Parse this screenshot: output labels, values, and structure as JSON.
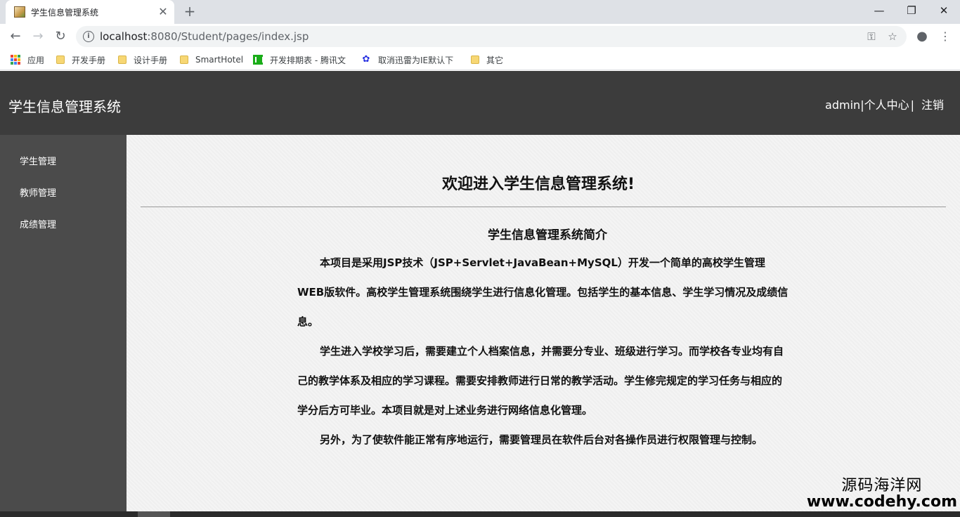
{
  "browser": {
    "tab_title": "学生信息管理系统",
    "tab_close_glyph": "✕",
    "new_tab_glyph": "+",
    "window_controls": {
      "minimize": "—",
      "restore": "❐",
      "close": "✕"
    },
    "url_host": "localhost",
    "url_path": ":8080/Student/pages/index.jsp",
    "bookmarks": [
      {
        "label": "应用",
        "icon": "apps-grid-icon"
      },
      {
        "label": "开发手册",
        "icon": "folder-icon"
      },
      {
        "label": "设计手册",
        "icon": "folder-icon"
      },
      {
        "label": "SmartHotel",
        "icon": "folder-icon"
      },
      {
        "label": "开发排期表 - 腾讯文",
        "icon": "tencent-doc-icon"
      },
      {
        "label": "取消迅雷为IE默认下",
        "icon": "baidu-paw-icon"
      },
      {
        "label": "其它",
        "icon": "folder-icon"
      }
    ]
  },
  "header": {
    "site_title": "学生信息管理系统",
    "username": "admin",
    "separator": "|",
    "profile_link": "个人中心",
    "logout_link": "注销"
  },
  "sidebar": {
    "items": [
      {
        "label": "学生管理"
      },
      {
        "label": "教师管理"
      },
      {
        "label": "成绩管理"
      }
    ]
  },
  "main": {
    "welcome_heading": "欢迎进入学生信息管理系统!",
    "intro_title": "学生信息管理系统简介",
    "paragraphs": [
      "本项目是采用JSP技术（JSP+Servlet+JavaBean+MySQL）开发一个简单的高校学生管理WEB版软件。高校学生管理系统围绕学生进行信息化管理。包括学生的基本信息、学生学习情况及成绩信息。",
      "学生进入学校学习后，需要建立个人档案信息，并需要分专业、班级进行学习。而学校各专业均有自己的教学体系及相应的学习课程。需要安排教师进行日常的教学活动。学生修完规定的学习任务与相应的学分后方可毕业。本项目就是对上述业务进行网络信息化管理。",
      "另外，为了使软件能正常有序地运行，需要管理员在软件后台对各操作员进行权限管理与控制。"
    ]
  },
  "watermark": {
    "line1": "源码海洋网",
    "line2": "www.codehy.com"
  }
}
